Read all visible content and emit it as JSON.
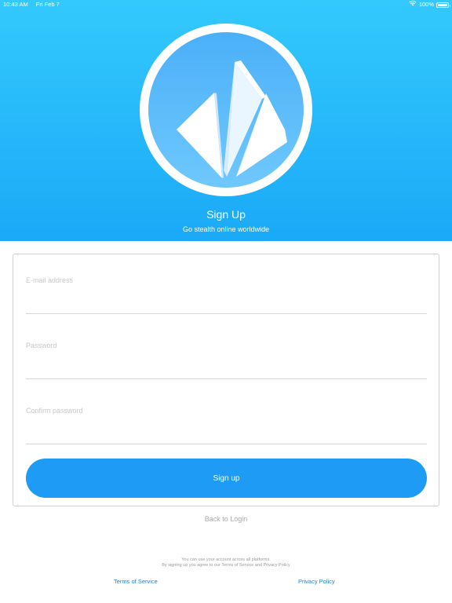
{
  "status_bar": {
    "time": "10:43 AM",
    "date": "Fri Feb 7",
    "battery": "100%",
    "battery_level": 1.0,
    "wifi_icon": "wifi-icon",
    "battery_icon": "battery-icon"
  },
  "header": {
    "logo_icon": "app-logo-icon",
    "title": "Sign Up",
    "subtitle": "Go stealth online worldwide"
  },
  "form": {
    "email_placeholder": "E-mail address",
    "email_value": "",
    "password_placeholder": "Password",
    "password_value": "",
    "confirm_placeholder": "Confirm password",
    "confirm_value": "",
    "submit_label": "Sign up"
  },
  "back_to_login": "Back to Login",
  "footer": {
    "note_line1": "You can use your account across all platforms.",
    "note_line2": "By signing up you agree to our Terms of Service and Privacy Policy",
    "terms_label": "Terms of Service",
    "privacy_label": "Privacy Policy"
  },
  "colors": {
    "accent": "#1e9bf5",
    "header_top": "#34c9fd",
    "header_bottom": "#1aa9f7",
    "link": "#1e7fd6"
  }
}
